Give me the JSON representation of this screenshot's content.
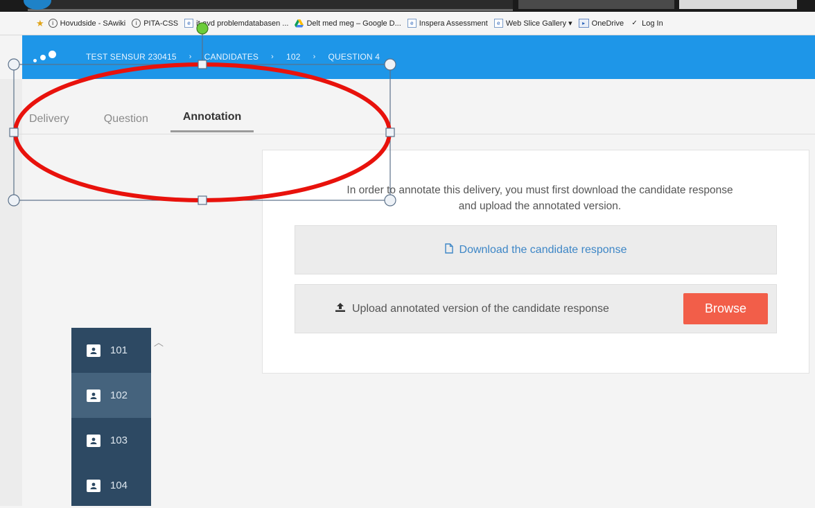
{
  "favorites": [
    {
      "icon": "info-circle-icon",
      "label": "Hovudside - SAwiki"
    },
    {
      "icon": "info-circle-icon",
      "label": "PITA-CSS"
    },
    {
      "icon": "ie-page-icon",
      "label": "it-avd problemdatabasen ..."
    },
    {
      "icon": "google-drive-icon",
      "label": "Delt med meg – Google D..."
    },
    {
      "icon": "ie-page-icon",
      "label": "Inspera Assessment"
    },
    {
      "icon": "ie-page-icon",
      "label": "Web Slice Gallery ▾"
    },
    {
      "icon": "onedrive-icon",
      "label": "OneDrive"
    },
    {
      "icon": "checkmark-icon",
      "label": "Log In"
    }
  ],
  "breadcrumb": [
    "TEST SENSUR 230415",
    "CANDIDATES",
    "102",
    "QUESTION 4"
  ],
  "breadcrumb_separator": "›",
  "tabs": [
    {
      "label": "Delivery",
      "active": false
    },
    {
      "label": "Question",
      "active": false
    },
    {
      "label": "Annotation",
      "active": true
    }
  ],
  "annotation_panel": {
    "instructions_line1": "In order to annotate this delivery, you must first download the candidate response",
    "instructions_line2": "and upload the annotated version.",
    "download_label": "Download the candidate response",
    "upload_label": "Upload annotated version of the candidate response",
    "browse_label": "Browse"
  },
  "candidates": [
    {
      "id": "101",
      "selected": false
    },
    {
      "id": "102",
      "selected": true
    },
    {
      "id": "103",
      "selected": false
    },
    {
      "id": "104",
      "selected": false
    }
  ],
  "colors": {
    "app_bar": "#1e96e8",
    "browse_button": "#f25e49",
    "candidate_list": "#2d4963",
    "candidate_selected": "#45637d",
    "highlight_ellipse": "#e8120c",
    "link": "#3d86c6"
  }
}
